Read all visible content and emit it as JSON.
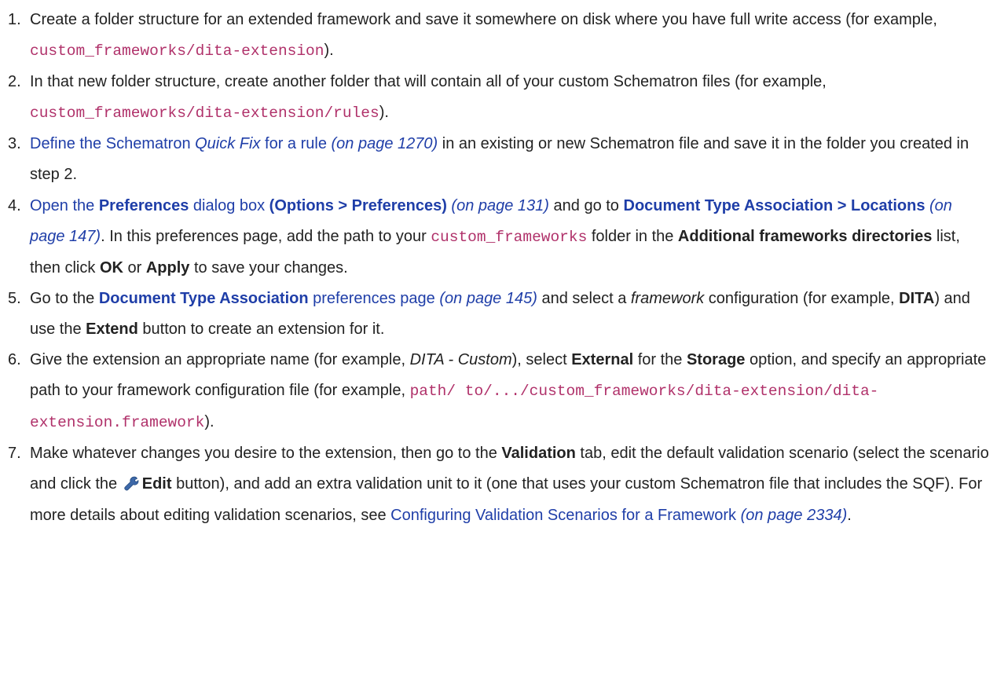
{
  "steps": [
    {
      "number": "1.",
      "text_a": "Create a folder structure for an extended framework and save it somewhere on disk where you have full write access (for example, ",
      "code_a": "custom_frameworks/dita-extension",
      "text_b": ")."
    },
    {
      "number": "2.",
      "text_a": "In that new folder structure, create another folder that will contain all of your custom Schematron files (for example, ",
      "code_a": "custom_frameworks/dita-extension/rules",
      "text_b": ")."
    },
    {
      "number": "3.",
      "link_a": "Define the Schematron ",
      "link_a_italic": "Quick Fix",
      "link_a_end": " for a rule",
      "page_a": " (on page 1270)",
      "text_a": " in an existing or new Schematron file and save it in the folder you created in step 2."
    },
    {
      "number": "4.",
      "link_a": "Open the ",
      "link_a_bold": "Preferences",
      "link_a_mid": " dialog box ",
      "link_a_bold2": "(Options > Preferences)",
      "page_a": " (on page 131)",
      "text_a": " and go to ",
      "link_b_bold": "Document Type Association > Locations",
      "page_b": " (on page 147)",
      "text_b": ". In this preferences page, add the path to your ",
      "code_a": "custom_frameworks",
      "text_c": " folder in the ",
      "bold_a": "Additional frameworks directories",
      "text_d": " list, then click ",
      "bold_b": "OK",
      "text_e": " or ",
      "bold_c": "Apply",
      "text_f": " to save your changes."
    },
    {
      "number": "5.",
      "text_a": "Go to the ",
      "link_bold": "Document Type Association",
      "link_plain": " preferences page",
      "page_a": " (on page 145)",
      "text_b": " and select a ",
      "italic_a": "framework",
      "text_c": " configuration (for example, ",
      "bold_a": "DITA",
      "text_d": ") and use the ",
      "bold_b": "Extend",
      "text_e": " button to create an extension for it."
    },
    {
      "number": "6.",
      "text_a": "Give the extension an appropriate name (for example, ",
      "italic_a": "DITA - Custom",
      "text_b": "), select ",
      "bold_a": "External",
      "text_c": " for the ",
      "bold_b": "Storage",
      "text_d": " option, and specify an appropriate path to your framework configuration file (for example, ",
      "code_a": "path/ to/.../custom_frameworks/dita-extension/dita-extension.framework",
      "text_e": ")."
    },
    {
      "number": "7.",
      "text_a": "Make whatever changes you desire to the extension, then go to the ",
      "bold_a": "Validation",
      "text_b": " tab, edit the default validation scenario (select the scenario and click the ",
      "icon": "wrench-icon",
      "bold_b": "Edit",
      "text_c": " button), and add an extra validation unit to it (one that uses your custom Schematron file that includes the SQF). For more details about editing validation scenarios, see ",
      "link_a": "Configuring Validation Scenarios for a Framework",
      "page_a": " (on page 2334)",
      "text_d": "."
    }
  ]
}
